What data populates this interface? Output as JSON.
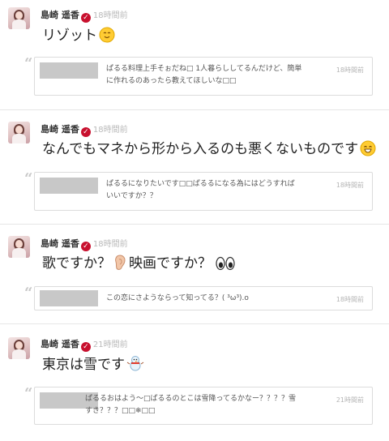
{
  "posts": [
    {
      "author": "島崎 遥香",
      "time": "18時間前",
      "message": "リゾット",
      "emoji": "smiling-face-emoji",
      "reply": {
        "text_line1": "ぱるる料理上手そぉだね□ 1人暮らししてるんだけど、簡単",
        "text_line2": "に作れるのあったら教えてほしいな□□",
        "time": "18時間前"
      }
    },
    {
      "author": "島崎 遥香",
      "time": "18時間前",
      "message": "なんでもマネから形から入るのも悪くないものです",
      "emoji": "grinning-face-emoji",
      "reply": {
        "text_line1": "ぱるるになりたいです□□ぱるるになる為にはどうすれば",
        "text_line2": "いいですか？？",
        "time": "18時間前"
      }
    },
    {
      "author": "島崎 遥香",
      "time": "18時間前",
      "message_part1": "歌ですか？",
      "message_part2": "映画ですか？",
      "emoji1": "ear-emoji",
      "emoji2": "eyes-emoji",
      "reply": {
        "text_line1": "この恋にさようならって知ってる？( ³ω³).o",
        "time": "18時間前"
      }
    },
    {
      "author": "島崎 遥香",
      "time": "21時間前",
      "message": "東京は雪です",
      "emoji": "snowman-emoji",
      "reply": {
        "text_line1": "ぱるるおはよう～□ぱるるのとこは雪降ってるかなー？？？？雪",
        "text_line2": "すき？？？□□❄□□",
        "time": "21時間前"
      }
    }
  ],
  "colors": {
    "verified": "#c8102e",
    "time": "#b9b9b9",
    "separator": "#e6e6e6",
    "reply_border": "#dcdcdc",
    "thumb": "#c8c8c8"
  }
}
